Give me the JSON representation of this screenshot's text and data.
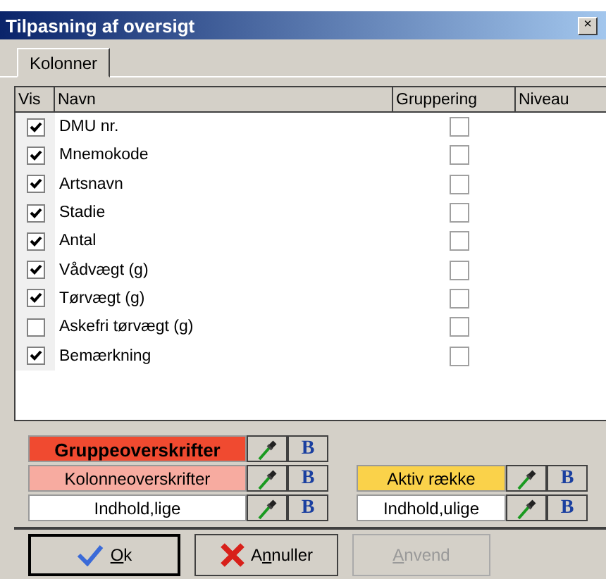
{
  "window": {
    "title": "Tilpasning af oversigt",
    "close": "×"
  },
  "tabs": [
    {
      "label": "Kolonner",
      "selected": true
    }
  ],
  "table": {
    "columns": [
      "Vis",
      "Navn",
      "Gruppering",
      "Niveau"
    ],
    "rows": [
      {
        "visible": true,
        "name": "DMU nr.",
        "grouping": false
      },
      {
        "visible": true,
        "name": "Mnemokode",
        "grouping": false
      },
      {
        "visible": true,
        "name": "Artsnavn",
        "grouping": false
      },
      {
        "visible": true,
        "name": "Stadie",
        "grouping": false
      },
      {
        "visible": true,
        "name": "Antal",
        "grouping": false
      },
      {
        "visible": true,
        "name": "Vådvægt (g)",
        "grouping": false
      },
      {
        "visible": true,
        "name": "Tørvægt (g)",
        "grouping": false
      },
      {
        "visible": false,
        "name": "Askefri tørvægt (g)",
        "grouping": false
      },
      {
        "visible": true,
        "name": "Bemærkning",
        "grouping": false
      }
    ]
  },
  "styles_left": [
    {
      "label": "Gruppeoverskrifter",
      "color": "#f04a30",
      "bold": true,
      "bold_button": "B"
    },
    {
      "label": "Kolonneoverskrifter",
      "color": "#f7aba0",
      "bold": false,
      "bold_button": "B"
    },
    {
      "label": "Indhold,lige",
      "color": "#ffffff",
      "bold": false,
      "bold_button": "B"
    }
  ],
  "styles_right": [
    {
      "label": "Aktiv række",
      "color": "#fad24a",
      "bold": false,
      "bold_button": "B"
    },
    {
      "label": "Indhold,ulige",
      "color": "#ffffff",
      "bold": false,
      "bold_button": "B"
    }
  ],
  "buttons": [
    {
      "kind": "ok",
      "key": "O",
      "post": "k",
      "disabled": false,
      "default": true
    },
    {
      "kind": "cancel",
      "pre": "A",
      "key": "n",
      "post": "nuller",
      "disabled": false,
      "default": false
    },
    {
      "kind": "apply",
      "key": "A",
      "post": "nvend",
      "disabled": true,
      "default": false
    }
  ]
}
